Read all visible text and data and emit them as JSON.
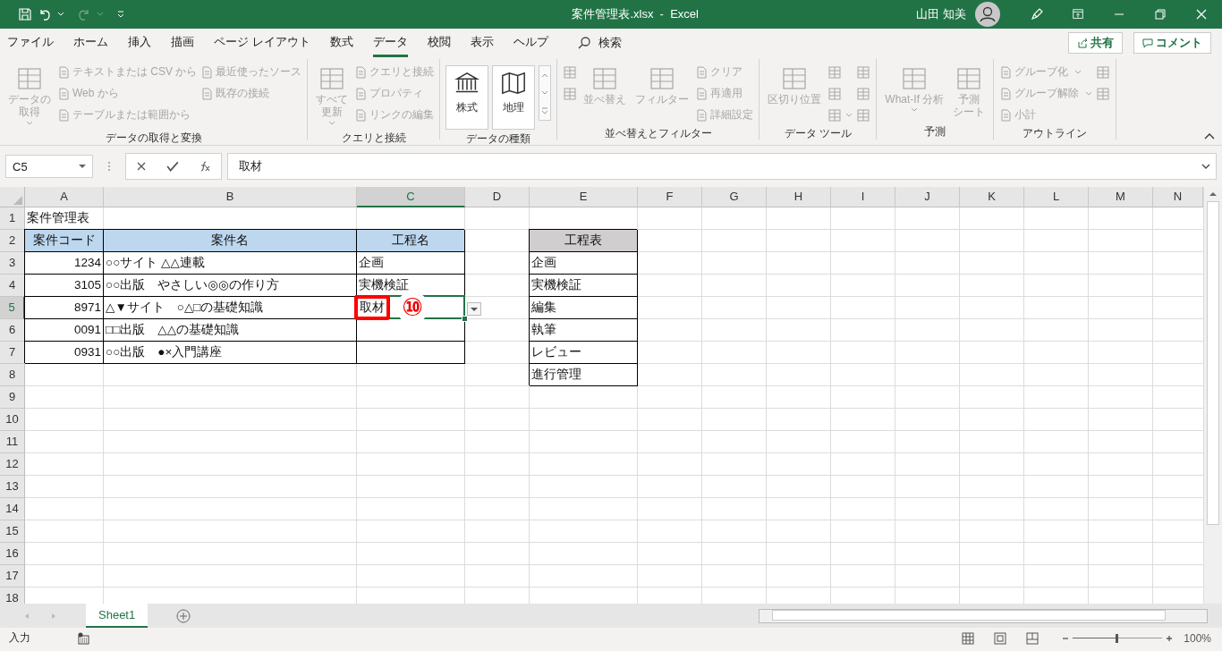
{
  "title_bar": {
    "title": "案件管理表.xlsx  -  Excel",
    "user": "山田 知美"
  },
  "menu_tabs": [
    {
      "label": "ファイル",
      "selected": false
    },
    {
      "label": "ホーム",
      "selected": false
    },
    {
      "label": "挿入",
      "selected": false
    },
    {
      "label": "描画",
      "selected": false
    },
    {
      "label": "ページ レイアウト",
      "selected": false
    },
    {
      "label": "数式",
      "selected": false
    },
    {
      "label": "データ",
      "selected": true
    },
    {
      "label": "校閲",
      "selected": false
    },
    {
      "label": "表示",
      "selected": false
    },
    {
      "label": "ヘルプ",
      "selected": false
    }
  ],
  "search": {
    "label": "検索"
  },
  "share_button": "共有",
  "comment_button": "コメント",
  "ribbon_groups": [
    {
      "label": "データの取得と変換",
      "columns": [
        [
          {
            "kind": "large",
            "lines": [
              "データの",
              "取得"
            ],
            "dropdown": true,
            "disabled": true
          }
        ],
        [
          {
            "kind": "small",
            "label": "テキストまたは CSV から",
            "disabled": true
          },
          {
            "kind": "small",
            "label": "Web から",
            "disabled": true
          },
          {
            "kind": "small",
            "label": "テーブルまたは範囲から",
            "disabled": true
          }
        ],
        [
          {
            "kind": "small",
            "label": "最近使ったソース",
            "disabled": true
          },
          {
            "kind": "small",
            "label": "既存の接続",
            "disabled": true
          }
        ]
      ]
    },
    {
      "label": "クエリと接続",
      "columns": [
        [
          {
            "kind": "large",
            "lines": [
              "すべて",
              "更新"
            ],
            "dropdown": true,
            "disabled": true
          }
        ],
        [
          {
            "kind": "small",
            "label": "クエリと接続",
            "disabled": true
          },
          {
            "kind": "small",
            "label": "プロパティ",
            "disabled": true
          },
          {
            "kind": "small",
            "label": "リンクの編集",
            "disabled": true
          }
        ]
      ]
    },
    {
      "label": "データの種類",
      "columns": [
        [
          {
            "kind": "gallery",
            "label": "株式",
            "disabled": false
          }
        ],
        [
          {
            "kind": "gallery",
            "label": "地理",
            "disabled": false
          }
        ]
      ]
    },
    {
      "label": "並べ替えとフィルター",
      "columns": [
        [
          {
            "kind": "icon",
            "disabled": true
          },
          {
            "kind": "icon",
            "disabled": true
          }
        ],
        [
          {
            "kind": "large",
            "lines": [
              "並べ替え"
            ],
            "disabled": true
          }
        ],
        [
          {
            "kind": "large",
            "lines": [
              "フィルター"
            ],
            "disabled": true
          }
        ],
        [
          {
            "kind": "small",
            "label": "クリア",
            "disabled": true
          },
          {
            "kind": "small",
            "label": "再適用",
            "disabled": true
          },
          {
            "kind": "small",
            "label": "詳細設定",
            "disabled": true
          }
        ]
      ]
    },
    {
      "label": "データ ツール",
      "columns": [
        [
          {
            "kind": "large",
            "lines": [
              "区切り位置"
            ],
            "disabled": true
          }
        ],
        [
          {
            "kind": "icon",
            "disabled": true
          },
          {
            "kind": "icon",
            "disabled": true
          },
          {
            "kind": "icon",
            "dropdown": true,
            "disabled": true
          }
        ],
        [
          {
            "kind": "icon",
            "disabled": true
          },
          {
            "kind": "icon",
            "disabled": true
          },
          {
            "kind": "icon",
            "disabled": true
          }
        ]
      ]
    },
    {
      "label": "予測",
      "columns": [
        [
          {
            "kind": "large",
            "lines": [
              "What-If 分析"
            ],
            "dropdown": true,
            "disabled": true
          }
        ],
        [
          {
            "kind": "large",
            "lines": [
              "予測",
              "シート"
            ],
            "disabled": true
          }
        ]
      ]
    },
    {
      "label": "アウトライン",
      "columns": [
        [
          {
            "kind": "small",
            "label": "グループ化",
            "dropdown": true,
            "disabled": true
          },
          {
            "kind": "small",
            "label": "グループ解除",
            "dropdown": true,
            "disabled": true
          },
          {
            "kind": "small",
            "label": "小計",
            "disabled": true
          }
        ],
        [
          {
            "kind": "icon",
            "disabled": true
          },
          {
            "kind": "icon",
            "disabled": true
          }
        ]
      ]
    }
  ],
  "formula_bar": {
    "name_box": "C5",
    "formula": "取材"
  },
  "columns": [
    {
      "label": "A",
      "selected": false
    },
    {
      "label": "B",
      "selected": false
    },
    {
      "label": "C",
      "selected": true
    },
    {
      "label": "D",
      "selected": false
    },
    {
      "label": "E",
      "selected": false
    },
    {
      "label": "F",
      "selected": false
    },
    {
      "label": "G",
      "selected": false
    },
    {
      "label": "H",
      "selected": false
    },
    {
      "label": "I",
      "selected": false
    },
    {
      "label": "J",
      "selected": false
    },
    {
      "label": "K",
      "selected": false
    },
    {
      "label": "L",
      "selected": false
    },
    {
      "label": "M",
      "selected": false
    },
    {
      "label": "N",
      "selected": false
    }
  ],
  "rows": [
    {
      "label": "1",
      "selected": false,
      "cells": [
        {
          "kind": "title",
          "text": "案件管理表"
        }
      ]
    },
    {
      "label": "2",
      "selected": false,
      "cells": [
        {
          "kind": "head_blue",
          "text": "案件コード"
        },
        {
          "kind": "head_blue",
          "text": "案件名"
        },
        {
          "kind": "head_blue",
          "text": "工程名"
        },
        {
          "kind": "blank"
        },
        {
          "kind": "head_grey",
          "text": "工程表"
        }
      ]
    },
    {
      "label": "3",
      "selected": false,
      "cells": [
        {
          "kind": "num",
          "text": "1234"
        },
        {
          "kind": "text",
          "text": "○○サイト △△連載"
        },
        {
          "kind": "text",
          "text": "企画"
        },
        {
          "kind": "blank"
        },
        {
          "kind": "text",
          "text": "企画"
        }
      ]
    },
    {
      "label": "4",
      "selected": false,
      "cells": [
        {
          "kind": "num",
          "text": "3105"
        },
        {
          "kind": "text",
          "text": "○○出版　やさしい◎◎の作り方"
        },
        {
          "kind": "text",
          "text": "実機検証"
        },
        {
          "kind": "blank"
        },
        {
          "kind": "text",
          "text": "実機検証"
        }
      ]
    },
    {
      "label": "5",
      "selected": true,
      "cells": [
        {
          "kind": "num",
          "text": "8971",
          "selected": false
        },
        {
          "kind": "text",
          "text": "△▼サイト　○△□の基礎知識",
          "selected": false
        },
        {
          "kind": "text",
          "text": "取材",
          "selected": true,
          "highlighted": true,
          "marker": "⑩",
          "dropdown": true
        },
        {
          "kind": "blank"
        },
        {
          "kind": "text",
          "text": "編集",
          "selected": false
        }
      ]
    },
    {
      "label": "6",
      "selected": false,
      "cells": [
        {
          "kind": "num",
          "text": "0091"
        },
        {
          "kind": "text",
          "text": "□□出版　△△の基礎知識"
        },
        {
          "kind": "empty"
        },
        {
          "kind": "blank"
        },
        {
          "kind": "text",
          "text": "執筆"
        }
      ]
    },
    {
      "label": "7",
      "selected": false,
      "cells": [
        {
          "kind": "num",
          "text": "0931"
        },
        {
          "kind": "text",
          "text": "○○出版　●×入門講座"
        },
        {
          "kind": "empty"
        },
        {
          "kind": "blank"
        },
        {
          "kind": "text",
          "text": "レビュー"
        }
      ]
    },
    {
      "label": "8",
      "selected": false,
      "cells": [
        {
          "kind": "blank"
        },
        {
          "kind": "blank"
        },
        {
          "kind": "blank"
        },
        {
          "kind": "blank"
        },
        {
          "kind": "text",
          "text": "進行管理"
        }
      ]
    },
    {
      "label": "9",
      "selected": false,
      "cells": []
    },
    {
      "label": "10",
      "selected": false,
      "cells": []
    },
    {
      "label": "11",
      "selected": false,
      "cells": []
    },
    {
      "label": "12",
      "selected": false,
      "cells": []
    },
    {
      "label": "13",
      "selected": false,
      "cells": []
    },
    {
      "label": "14",
      "selected": false,
      "cells": []
    },
    {
      "label": "15",
      "selected": false,
      "cells": []
    },
    {
      "label": "16",
      "selected": false,
      "cells": []
    },
    {
      "label": "17",
      "selected": false,
      "cells": []
    },
    {
      "label": "18",
      "selected": false,
      "cells": []
    }
  ],
  "sheet_tabs": [
    {
      "label": "Sheet1",
      "selected": true
    }
  ],
  "status_bar": {
    "mode": "入力",
    "zoom": "100%",
    "level": 0.5
  }
}
